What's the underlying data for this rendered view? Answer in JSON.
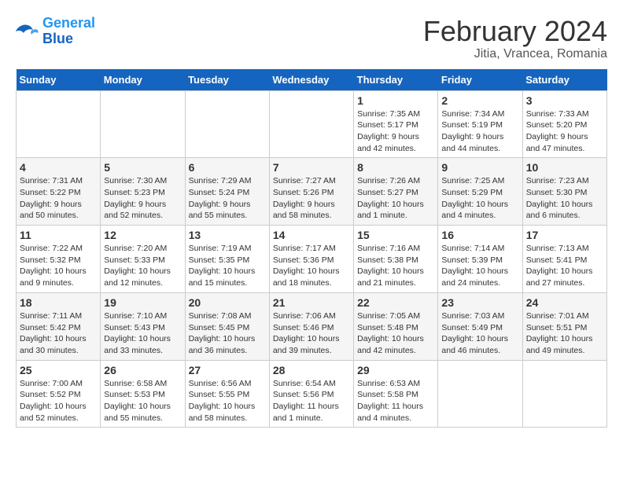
{
  "header": {
    "logo_line1": "General",
    "logo_line2": "Blue",
    "month_title": "February 2024",
    "location": "Jitia, Vrancea, Romania"
  },
  "days_of_week": [
    "Sunday",
    "Monday",
    "Tuesday",
    "Wednesday",
    "Thursday",
    "Friday",
    "Saturday"
  ],
  "weeks": [
    [
      {
        "day": "",
        "info": ""
      },
      {
        "day": "",
        "info": ""
      },
      {
        "day": "",
        "info": ""
      },
      {
        "day": "",
        "info": ""
      },
      {
        "day": "1",
        "info": "Sunrise: 7:35 AM\nSunset: 5:17 PM\nDaylight: 9 hours\nand 42 minutes."
      },
      {
        "day": "2",
        "info": "Sunrise: 7:34 AM\nSunset: 5:19 PM\nDaylight: 9 hours\nand 44 minutes."
      },
      {
        "day": "3",
        "info": "Sunrise: 7:33 AM\nSunset: 5:20 PM\nDaylight: 9 hours\nand 47 minutes."
      }
    ],
    [
      {
        "day": "4",
        "info": "Sunrise: 7:31 AM\nSunset: 5:22 PM\nDaylight: 9 hours\nand 50 minutes."
      },
      {
        "day": "5",
        "info": "Sunrise: 7:30 AM\nSunset: 5:23 PM\nDaylight: 9 hours\nand 52 minutes."
      },
      {
        "day": "6",
        "info": "Sunrise: 7:29 AM\nSunset: 5:24 PM\nDaylight: 9 hours\nand 55 minutes."
      },
      {
        "day": "7",
        "info": "Sunrise: 7:27 AM\nSunset: 5:26 PM\nDaylight: 9 hours\nand 58 minutes."
      },
      {
        "day": "8",
        "info": "Sunrise: 7:26 AM\nSunset: 5:27 PM\nDaylight: 10 hours\nand 1 minute."
      },
      {
        "day": "9",
        "info": "Sunrise: 7:25 AM\nSunset: 5:29 PM\nDaylight: 10 hours\nand 4 minutes."
      },
      {
        "day": "10",
        "info": "Sunrise: 7:23 AM\nSunset: 5:30 PM\nDaylight: 10 hours\nand 6 minutes."
      }
    ],
    [
      {
        "day": "11",
        "info": "Sunrise: 7:22 AM\nSunset: 5:32 PM\nDaylight: 10 hours\nand 9 minutes."
      },
      {
        "day": "12",
        "info": "Sunrise: 7:20 AM\nSunset: 5:33 PM\nDaylight: 10 hours\nand 12 minutes."
      },
      {
        "day": "13",
        "info": "Sunrise: 7:19 AM\nSunset: 5:35 PM\nDaylight: 10 hours\nand 15 minutes."
      },
      {
        "day": "14",
        "info": "Sunrise: 7:17 AM\nSunset: 5:36 PM\nDaylight: 10 hours\nand 18 minutes."
      },
      {
        "day": "15",
        "info": "Sunrise: 7:16 AM\nSunset: 5:38 PM\nDaylight: 10 hours\nand 21 minutes."
      },
      {
        "day": "16",
        "info": "Sunrise: 7:14 AM\nSunset: 5:39 PM\nDaylight: 10 hours\nand 24 minutes."
      },
      {
        "day": "17",
        "info": "Sunrise: 7:13 AM\nSunset: 5:41 PM\nDaylight: 10 hours\nand 27 minutes."
      }
    ],
    [
      {
        "day": "18",
        "info": "Sunrise: 7:11 AM\nSunset: 5:42 PM\nDaylight: 10 hours\nand 30 minutes."
      },
      {
        "day": "19",
        "info": "Sunrise: 7:10 AM\nSunset: 5:43 PM\nDaylight: 10 hours\nand 33 minutes."
      },
      {
        "day": "20",
        "info": "Sunrise: 7:08 AM\nSunset: 5:45 PM\nDaylight: 10 hours\nand 36 minutes."
      },
      {
        "day": "21",
        "info": "Sunrise: 7:06 AM\nSunset: 5:46 PM\nDaylight: 10 hours\nand 39 minutes."
      },
      {
        "day": "22",
        "info": "Sunrise: 7:05 AM\nSunset: 5:48 PM\nDaylight: 10 hours\nand 42 minutes."
      },
      {
        "day": "23",
        "info": "Sunrise: 7:03 AM\nSunset: 5:49 PM\nDaylight: 10 hours\nand 46 minutes."
      },
      {
        "day": "24",
        "info": "Sunrise: 7:01 AM\nSunset: 5:51 PM\nDaylight: 10 hours\nand 49 minutes."
      }
    ],
    [
      {
        "day": "25",
        "info": "Sunrise: 7:00 AM\nSunset: 5:52 PM\nDaylight: 10 hours\nand 52 minutes."
      },
      {
        "day": "26",
        "info": "Sunrise: 6:58 AM\nSunset: 5:53 PM\nDaylight: 10 hours\nand 55 minutes."
      },
      {
        "day": "27",
        "info": "Sunrise: 6:56 AM\nSunset: 5:55 PM\nDaylight: 10 hours\nand 58 minutes."
      },
      {
        "day": "28",
        "info": "Sunrise: 6:54 AM\nSunset: 5:56 PM\nDaylight: 11 hours\nand 1 minute."
      },
      {
        "day": "29",
        "info": "Sunrise: 6:53 AM\nSunset: 5:58 PM\nDaylight: 11 hours\nand 4 minutes."
      },
      {
        "day": "",
        "info": ""
      },
      {
        "day": "",
        "info": ""
      }
    ]
  ]
}
